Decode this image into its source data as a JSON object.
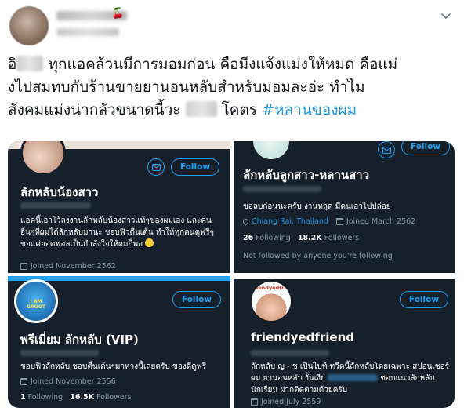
{
  "tweet": {
    "author": {
      "avatar_icon": "profile-avatar-blurred",
      "name_emoji": "🍒"
    },
    "text_lines": [
      {
        "a": "อิ",
        "b": " ทุกแอคล้วนมีการมอมก่อน คือมึงแจ้งแม่งให้หมด คือแม่"
      },
      {
        "a": "งไปสมทบกับร้านขายยานอนหลับสำหรับมอมละอ่ะ ทำไม"
      },
      {
        "a": "สังคมแม่งน่ากลัวขนาดนี้วะ ",
        "b": " โคตร ",
        "hashtag": "#หลานของผม"
      }
    ]
  },
  "cards": [
    {
      "name": "ลักหลับน้องสาว",
      "bio": "แอคนี้เอาไว้ลงงานลักหลับน้องสาวแท้ๆของผมเอง และคนอื่นๆที่ผมได้ลักหลับมานะ ชอบฟิวตื่นเต้น ทำให้ทุกคนดูฟรีๆ ขอแค่ยอดฟอลเป็นกำลังใจให้ผมก็พอ",
      "joined": "Joined November 2562",
      "follow_label": "Follow"
    },
    {
      "name": "ลักหลับลูกสาว-หลานสาว",
      "bio": "ขอลบก่อนนะครับ งานหลุด มีคนเอาไปปล่อย",
      "location": "Chiang Rai, Thailand",
      "joined": "Joined March 2562",
      "following_count": "26",
      "following_label": "Following",
      "followers_count": "18.2K",
      "followers_label": "Followers",
      "note": "Not followed by anyone you're following",
      "follow_label": "Follow"
    },
    {
      "name": "พรีเมี่ยม ลักหลับ (VIP)",
      "bio": "ชอบฟิวลักหลับ ชอบตื่นเต้นๆมาทางนี้เลยครับ ของดีดูฟรี",
      "joined": "Joined November 2556",
      "following_count": "1",
      "following_label": "Following",
      "followers_count": "16.5K",
      "followers_label": "Followers",
      "follow_label": "Follow",
      "avatar_text": "I AM GROOT"
    },
    {
      "name": "friendyedfriend",
      "bio_1": "ลักหลับ ญ - ช เป็นไบท์ ทวีตนี้ลักหลับโดยเฉพาะ สปอนเซอร์ผม ยานอนหลับ งั้นเงี่ย",
      "bio_2": "ชอบแนวลักหลับนักเรียน ฝากติดตามด้วยครับ",
      "joined": "Joined July 2559",
      "follow_label": "Follow",
      "avatar_text": "friendyedfriend"
    }
  ],
  "colors": {
    "card_bg": "#15202b",
    "accent": "#1da1f2",
    "hashtag": "#1b95e0",
    "muted": "#8899a6"
  }
}
